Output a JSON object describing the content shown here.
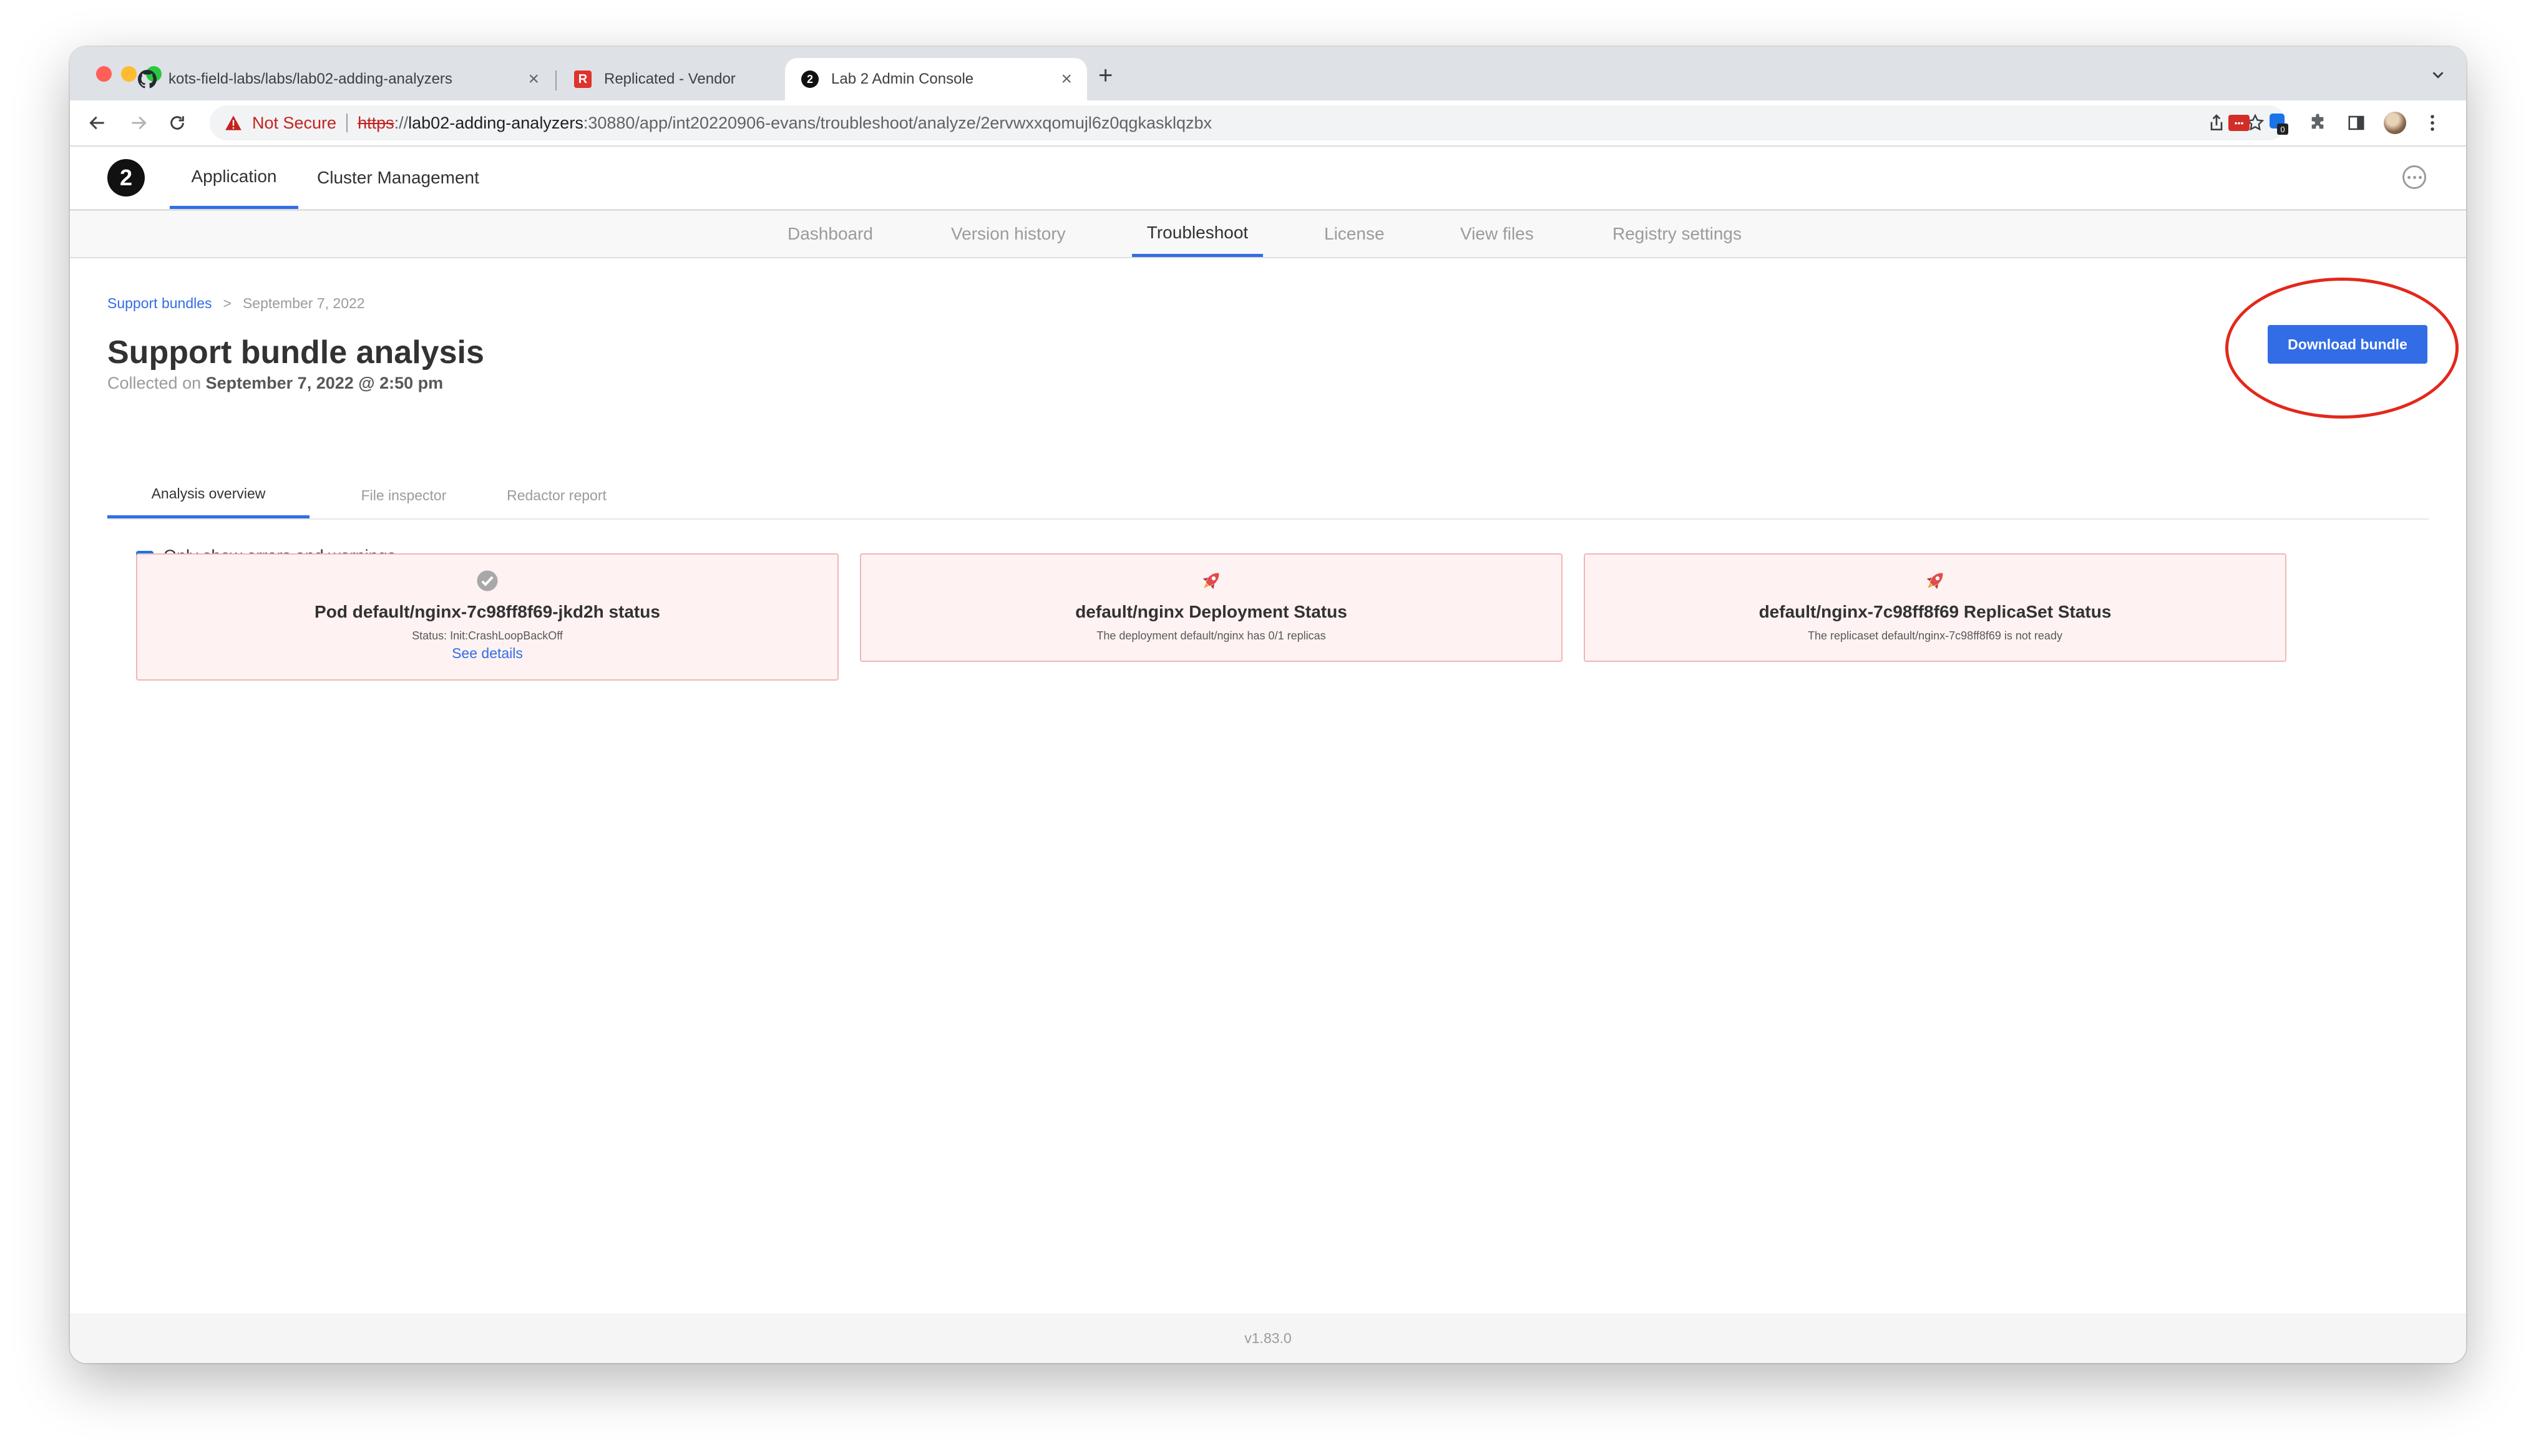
{
  "browser": {
    "tabs": [
      {
        "label": "kots-field-labs/labs/lab02-adding-analyzers",
        "favicon": "github-icon"
      },
      {
        "label": "Replicated - Vendor",
        "favicon": "replicated-icon",
        "favicon_text": "R"
      },
      {
        "label": "Lab 2 Admin Console",
        "favicon": "app-logo-icon",
        "favicon_text": "2"
      }
    ],
    "security_label": "Not Secure",
    "url_scheme": "https",
    "url_host": "lab02-adding-analyzers",
    "url_rest": ":30880/app/int20220906-evans/troubleshoot/analyze/2ervwxxqomujl6z0qgkasklqzbx",
    "extension_badge": "0"
  },
  "app": {
    "logo_text": "2",
    "nav": [
      "Application",
      "Cluster Management"
    ],
    "subnav": [
      "Dashboard",
      "Version history",
      "Troubleshoot",
      "License",
      "View files",
      "Registry settings"
    ],
    "breadcrumb": {
      "parent": "Support bundles",
      "separator": ">",
      "current": "September 7, 2022"
    },
    "title": "Support bundle analysis",
    "collected_prefix": "Collected on",
    "collected_date": "September 7, 2022 @ 2:50 pm",
    "download_label": "Download bundle",
    "inner_tabs": [
      "Analysis overview",
      "File inspector",
      "Redactor report"
    ],
    "filter_label": "Only show errors and warnings",
    "filter_checked": true,
    "cards": [
      {
        "title": "Pod default/nginx-7c98ff8f69-jkd2h status",
        "message": "Status: Init:CrashLoopBackOff",
        "link": "See details",
        "icon": "check-circle-icon"
      },
      {
        "title": "default/nginx Deployment Status",
        "message": "The deployment default/nginx has 0/1 replicas",
        "icon": "rocket-icon"
      },
      {
        "title": "default/nginx-7c98ff8f69 ReplicaSet Status",
        "message": "The replicaset default/nginx-7c98ff8f69 is not ready",
        "icon": "rocket-icon"
      }
    ],
    "version": "v1.83.0"
  },
  "colors": {
    "accent": "#326de6",
    "card_error_bg": "#fef2f2",
    "card_error_border": "#f0b7b7",
    "annotation": "#e3281b"
  }
}
